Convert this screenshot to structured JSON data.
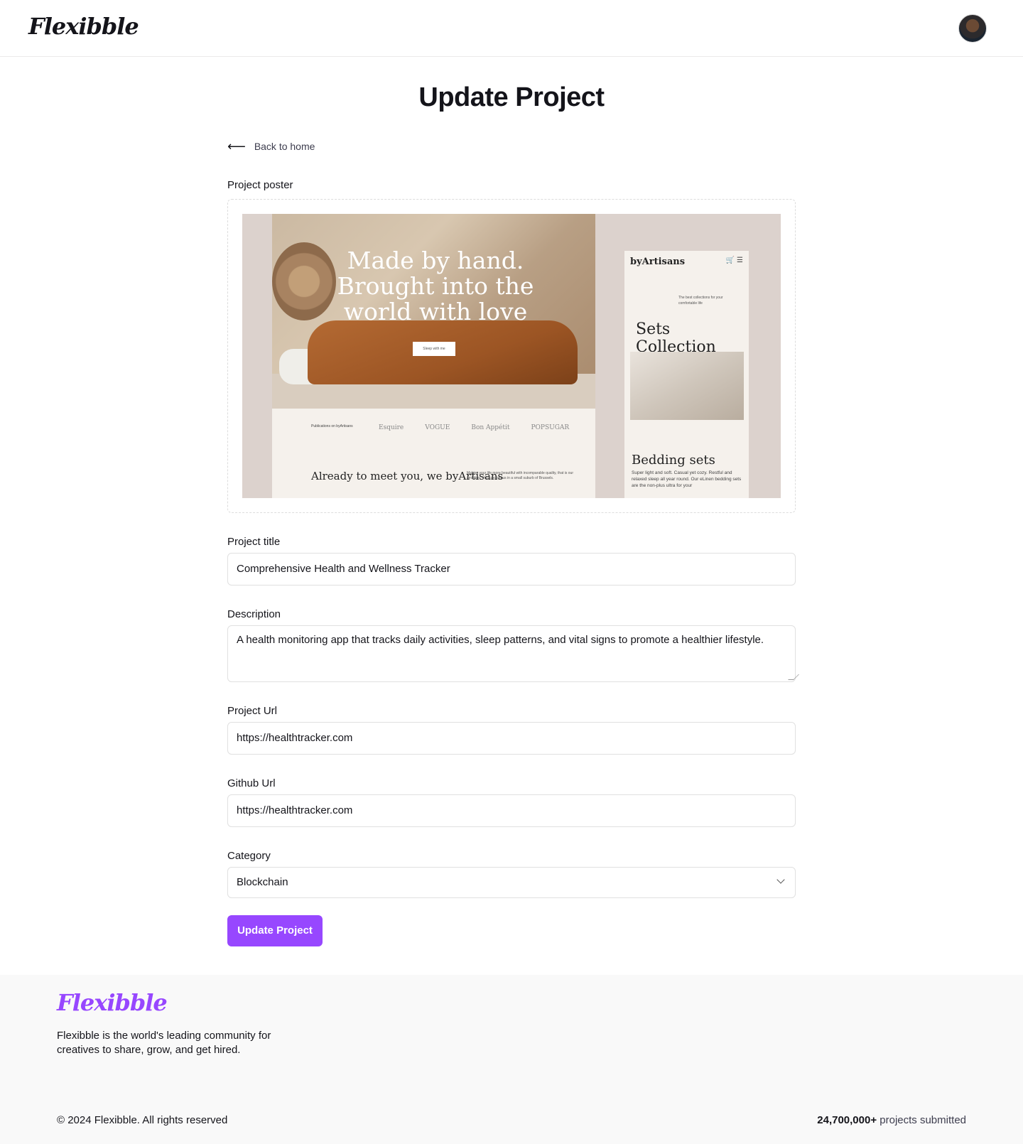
{
  "navbar": {
    "logo": "Flexibble"
  },
  "main": {
    "title": "Update Project",
    "back_label": "Back to home",
    "poster_label": "Project poster",
    "poster": {
      "hero_text": "Made by hand. Brought into the world with love",
      "hero_button": "Sleep with me",
      "publications": "Publications on byArtisans",
      "brands": [
        "Esquire",
        "VOGUE",
        "Bon Appétit",
        "POPSUGAR"
      ],
      "meet_text": "Already to meet you, we byArtisans",
      "meet_small": "Making your life more beautiful with incomparable quality, that is our ambition. You can find us in a small suburb of Brussels.",
      "mobile_brand": "byArtisans",
      "mobile_tagline": "The best collections for your comfortable life",
      "mobile_heading": "Sets Collection",
      "mobile_subheading": "Bedding sets",
      "mobile_desc": "Super light and soft. Casual yet cozy. Restful and relaxed sleep all year round. Our eLinen bedding sets are the non-plus ultra for your"
    },
    "title_label": "Project title",
    "title_value": "Comprehensive Health and Wellness Tracker",
    "description_label": "Description",
    "description_value": "A health monitoring app that tracks daily activities, sleep patterns, and vital signs to promote a healthier lifestyle.",
    "project_url_label": "Project Url",
    "project_url_value": "https://healthtracker.com",
    "github_url_label": "Github Url",
    "github_url_value": "https://healthtracker.com",
    "category_label": "Category",
    "category_value": "Blockchain",
    "submit_label": "Update Project"
  },
  "footer": {
    "logo": "Flexibble",
    "description": "Flexibble is the world's leading community for creatives to share, grow, and get hired.",
    "copyright": "© 2024 Flexibble. All rights reserved",
    "stats_count": "24,700,000+",
    "stats_label": " projects submitted"
  },
  "colors": {
    "accent": "#9747ff",
    "text": "#14141a"
  }
}
